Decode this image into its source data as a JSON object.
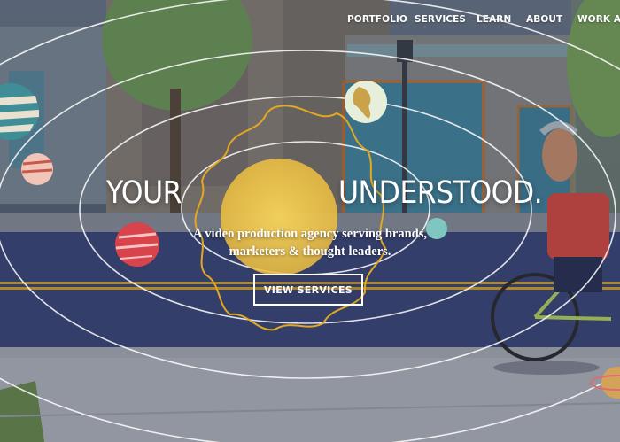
{
  "nav": {
    "items": [
      {
        "label": "PORTFOLIO"
      },
      {
        "label": "SERVICES"
      },
      {
        "label": "LEARN"
      },
      {
        "label": "ABOUT"
      },
      {
        "label": "WORK AT E"
      }
    ]
  },
  "hero": {
    "headline_left": "YOUR",
    "headline_right": "UNDERSTOOD.",
    "subtitle_line1": "A video production agency serving brands,",
    "subtitle_line2": "marketers & thought leaders.",
    "cta_label": "VIEW SERVICES"
  },
  "colors": {
    "sun": "#f2c94c",
    "orbit": "#ffffff",
    "road": "#3c4677",
    "road_line": "#d9a521",
    "tree": "#6f9a55",
    "shirt": "#d8483e"
  },
  "icons": [
    "planet-striped-icon",
    "planet-earth-icon",
    "planet-red-icon",
    "planet-small-icon",
    "sun-icon"
  ]
}
